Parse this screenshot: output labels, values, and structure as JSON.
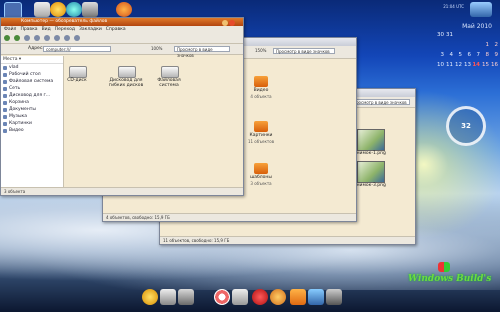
{
  "top_panel": {
    "time": "21:04 UTC"
  },
  "calendar": {
    "title": "Май 2010",
    "rows": [
      [
        "",
        "",
        "",
        "",
        "",
        "1",
        "2"
      ],
      [
        "3",
        "4",
        "5",
        "6",
        "7",
        "8",
        "9"
      ],
      [
        "10",
        "11",
        "12",
        "13",
        "14",
        "15",
        "16"
      ],
      [
        "30",
        "31",
        "",
        "",
        "",
        "",
        ""
      ]
    ],
    "extra_rows": [
      [
        "",
        "",
        "",
        "",
        "",
        "1",
        "2"
      ],
      [
        "3",
        "4",
        "5",
        "6",
        "7",
        "8",
        "9"
      ],
      [
        "10",
        "11",
        "12",
        "13",
        "14",
        "15",
        "16"
      ]
    ],
    "today": "14"
  },
  "gauge": {
    "value": "32"
  },
  "win_front": {
    "title": "Компьютер — обозреватель файлов",
    "menu": [
      "Файл",
      "Правка",
      "Вид",
      "Переход",
      "Закладки",
      "Справка"
    ],
    "address_label": "Адрес:",
    "address": "computer:///",
    "zoom": "100%",
    "view": "Просмотр в виде значков",
    "sidebar_head": "Места ▾",
    "sidebar": [
      "vlad",
      "Рабочий стол",
      "Файловая система",
      "Сеть",
      "Дисковод для г...",
      "Корзина",
      "Документы",
      "Музыка",
      "Картинки",
      "Видео"
    ],
    "items": [
      "CD-диск",
      "Дисковод для гибких дисков",
      "Файловая система"
    ],
    "status": "3 объекта"
  },
  "win_mid": {
    "title": "vlad — обозреватель файлов",
    "zoom": "150%",
    "view": "Просмотр в виде значков",
    "folders": [
      {
        "name": "Видео",
        "sub": "4 объекта"
      },
      {
        "name": "Картинки",
        "sub": "11 объектов"
      },
      {
        "name": "шаблоны",
        "sub": "3 объекта"
      }
    ],
    "status": "4 объектов, свободно: 15,9 ГБ"
  },
  "win_back": {
    "title": "Картинки — обозреватель файлов",
    "view": "Просмотр в виде значков",
    "thumbs": [
      "снимок-1.png",
      "снимок-3.png"
    ],
    "status": "11 объектов, свободно: 15,9 ГБ"
  },
  "brand": {
    "name": "Windows Build's"
  },
  "colors": {
    "accent": "#d85f0a",
    "title_active": "#c75a1b"
  }
}
